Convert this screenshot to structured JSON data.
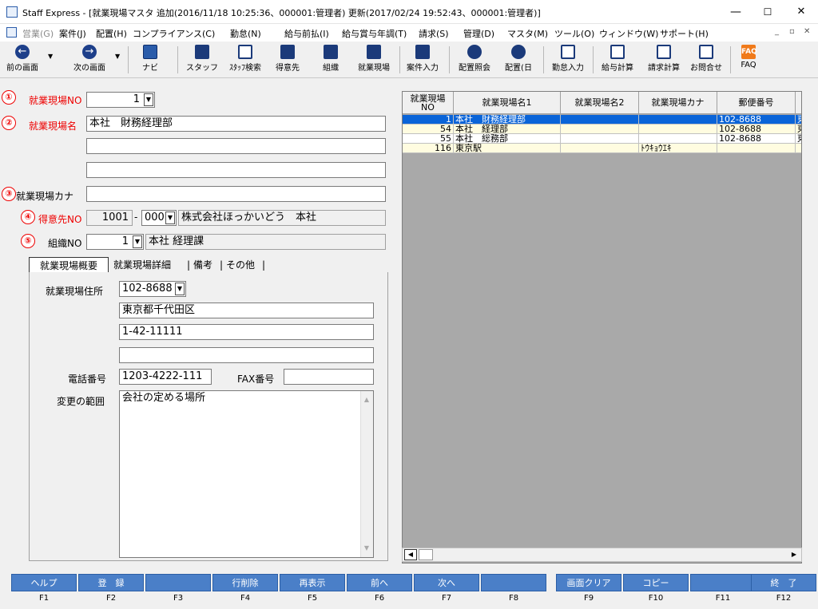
{
  "window": {
    "title": "Staff Express - [就業現場マスタ 追加(2016/11/18 10:25:36、000001:管理者) 更新(2017/02/24 19:52:43、000001:管理者)]",
    "min": "—",
    "max": "☐",
    "close": "✕"
  },
  "menu": [
    "営業(G)",
    "案件(J)",
    "配置(H)",
    "コンプライアンス(C)",
    "勤怠(N)",
    "給与前払(I)",
    "給与賞与年調(T)",
    "請求(S)",
    "管理(D)",
    "マスタ(M)",
    "ツール(O)",
    "ウィンドウ(W)",
    "サポート(H)"
  ],
  "mdi_controls": [
    "_",
    "▫",
    "✕"
  ],
  "toolbar": [
    {
      "label": "前の画面",
      "icon": "arrow-left-icon"
    },
    {
      "label": "次の画面",
      "icon": "arrow-right-icon"
    },
    {
      "label": "ナビ",
      "icon": "navi-icon"
    },
    {
      "label": "スタッフ",
      "icon": "staff-icon"
    },
    {
      "label": "ｽﾀｯﾌ検索",
      "icon": "staff-search-icon"
    },
    {
      "label": "得意先",
      "icon": "client-icon"
    },
    {
      "label": "組織",
      "icon": "org-icon"
    },
    {
      "label": "就業現場",
      "icon": "site-icon"
    },
    {
      "label": "案件入力",
      "icon": "case-input-icon"
    },
    {
      "label": "配置照会",
      "icon": "assignment-query-icon"
    },
    {
      "label": "配置(日",
      "icon": "assignment-day-icon"
    },
    {
      "label": "勤怠入力",
      "icon": "attendance-icon"
    },
    {
      "label": "給与計算",
      "icon": "payroll-icon"
    },
    {
      "label": "請求計算",
      "icon": "billing-icon"
    },
    {
      "label": "お問合せ",
      "icon": "inquiry-icon"
    },
    {
      "label": "FAQ",
      "icon": "faq-icon"
    }
  ],
  "indicators": [
    "①",
    "②",
    "③",
    "④",
    "⑤"
  ],
  "form": {
    "site_no_label": "就業現場NO",
    "site_no": "1",
    "site_name_label": "就業現場名",
    "site_name1": "本社　財務経理部",
    "site_name2": "",
    "site_name3": "",
    "site_kana_label": "就業現場カナ",
    "site_kana": "",
    "client_label": "得意先NO",
    "client_no": "1001",
    "client_dash": "-",
    "client_branch": "000",
    "client_name": "株式会社ほっかいどう　本社",
    "org_label": "組織NO",
    "org_no": "1",
    "org_name": "本社 経理課"
  },
  "tabs": [
    "就業現場概要",
    "就業現場詳細",
    "備考",
    "その他"
  ],
  "tab_sep": "|",
  "detail": {
    "address_label": "就業現場住所",
    "postal": "102-8688",
    "address1": "東京都千代田区",
    "address2": "1-42-11111",
    "address3": "",
    "phone_label": "電話番号",
    "phone": "1203-4222-111",
    "fax_label": "FAX番号",
    "fax": "",
    "scope_label": "変更の範囲",
    "scope": "会社の定める場所"
  },
  "grid": {
    "headers": [
      "就業現場\nNO",
      "就業現場名1",
      "就業現場名2",
      "就業現場カナ",
      "郵便番号",
      ""
    ],
    "rows": [
      {
        "no": "1",
        "name1": "本社　財務経理部",
        "name2": "",
        "kana": "",
        "postal": "102-8688",
        "extra": "東"
      },
      {
        "no": "54",
        "name1": "本社　経理部",
        "name2": "",
        "kana": "",
        "postal": "102-8688",
        "extra": "東"
      },
      {
        "no": "55",
        "name1": "本社　総務部",
        "name2": "",
        "kana": "",
        "postal": "102-8688",
        "extra": "東"
      },
      {
        "no": "116",
        "name1": "東京駅",
        "name2": "",
        "kana": "ﾄｳｷｮｳｴｷ",
        "postal": "",
        "extra": ""
      }
    ]
  },
  "fkeys": [
    {
      "label": "ヘルプ",
      "key": "F1"
    },
    {
      "label": "登　録",
      "key": "F2"
    },
    {
      "label": "",
      "key": "F3"
    },
    {
      "label": "行削除",
      "key": "F4"
    },
    {
      "label": "再表示",
      "key": "F5"
    },
    {
      "label": "前へ",
      "key": "F6"
    },
    {
      "label": "次へ",
      "key": "F7"
    },
    {
      "label": "",
      "key": "F8"
    },
    {
      "label": "画面クリア",
      "key": "F9"
    },
    {
      "label": "コピー",
      "key": "F10"
    },
    {
      "label": "",
      "key": "F11"
    },
    {
      "label": "終　了",
      "key": "F12"
    }
  ]
}
